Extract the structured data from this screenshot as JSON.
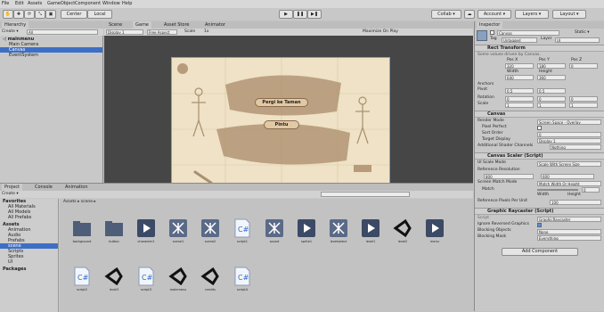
{
  "menu": [
    "File",
    "Edit",
    "Assets",
    "GameObject",
    "Component",
    "Window",
    "Help"
  ],
  "toolbar": {
    "center": "Center",
    "local": "Local",
    "collab": "Collab ▾",
    "account": "Account ▾",
    "layers": "Layers ▾",
    "layout": "Layout ▾"
  },
  "hierarchy": {
    "tab": "Hierarchy",
    "create": "Create ▾",
    "search": "All",
    "scene": "mainmenu",
    "items": [
      "Main Camera",
      "Canvas",
      "EventSystem"
    ]
  },
  "scene_tabs": [
    "Scene",
    "Game",
    "Asset Store",
    "Animator"
  ],
  "game": {
    "display": "Display 1",
    "aspect": "Free Aspect",
    "scale_label": "Scale",
    "scale_val": "1x",
    "maximize": "Maximize On Play",
    "button1": "Pergi ke Taman",
    "button2": "Pintu"
  },
  "project": {
    "tabs": [
      "Project",
      "Console",
      "Animation"
    ],
    "create": "Create ▾",
    "breadcrumb": "Assets ▸ scene ▸",
    "tree": [
      "Favorites",
      "All Materials",
      "All Models",
      "All Prefabs",
      "Assets",
      "Animation",
      "Audio",
      "Prefabs",
      "scene",
      "Scripts",
      "Sprites",
      "UI",
      "Packages"
    ],
    "row1": [
      "background",
      "button",
      "character1",
      "scene1",
      "scene2",
      "script1",
      "sound",
      "sprite1",
      "levelselect",
      "level1",
      "level2",
      "menu"
    ],
    "row2": [
      "script2",
      "level3",
      "script3",
      "mainmenu",
      "credits",
      "script4"
    ]
  },
  "inspector": {
    "tab": "Inspector",
    "object": "Canvas",
    "tag_label": "Tag",
    "tag": "Untagged",
    "layer_label": "Layer",
    "layer": "UI",
    "static": "Static ▾",
    "rect": "Rect Transform",
    "rect_note": "Some values driven by Canvas.",
    "pos": [
      "Pos X",
      "Pos Y",
      "Pos Z"
    ],
    "pos_vals": [
      "320",
      "180",
      "0"
    ],
    "size": [
      "Width",
      "Height"
    ],
    "size_vals": [
      "640",
      "360"
    ],
    "anchors": "Anchors",
    "pivot": "Pivot",
    "pivot_vals": [
      "0.5",
      "0.5"
    ],
    "rotation": "Rotation",
    "rotation_vals": [
      "0",
      "0",
      "0"
    ],
    "scale": "Scale",
    "scale_vals": [
      "1",
      "1",
      "1"
    ],
    "canvas": "Canvas",
    "render_mode": "Render Mode",
    "render_mode_val": "Screen Space - Overlay",
    "pixel_perfect": "Pixel Perfect",
    "sort_order": "Sort Order",
    "sort_order_val": "0",
    "target_display": "Target Display",
    "target_display_val": "Display 1",
    "shader_channels": "Additional Shader Channels",
    "shader_channels_val": "Nothing",
    "scaler": "Canvas Scaler (Script)",
    "scale_mode": "UI Scale Mode",
    "scale_mode_val": "Scale With Screen Size",
    "ref_res": "Reference Resolution",
    "ref_x": "800",
    "ref_y": "600",
    "match_mode": "Screen Match Mode",
    "match_mode_val": "Match Width Or Height",
    "match": "Match",
    "match_val": "0",
    "width_lbl": "Width",
    "height_lbl": "Height",
    "ref_ppu": "Reference Pixels Per Unit",
    "ref_ppu_val": "100",
    "raycaster": "Graphic Raycaster (Script)",
    "script_lbl": "Script",
    "script_val": "GraphicRaycaster",
    "ignore": "Ignore Reversed Graphics",
    "blocking_obj": "Blocking Objects",
    "blocking_obj_val": "None",
    "blocking_mask": "Blocking Mask",
    "blocking_mask_val": "Everything",
    "add_component": "Add Component"
  }
}
